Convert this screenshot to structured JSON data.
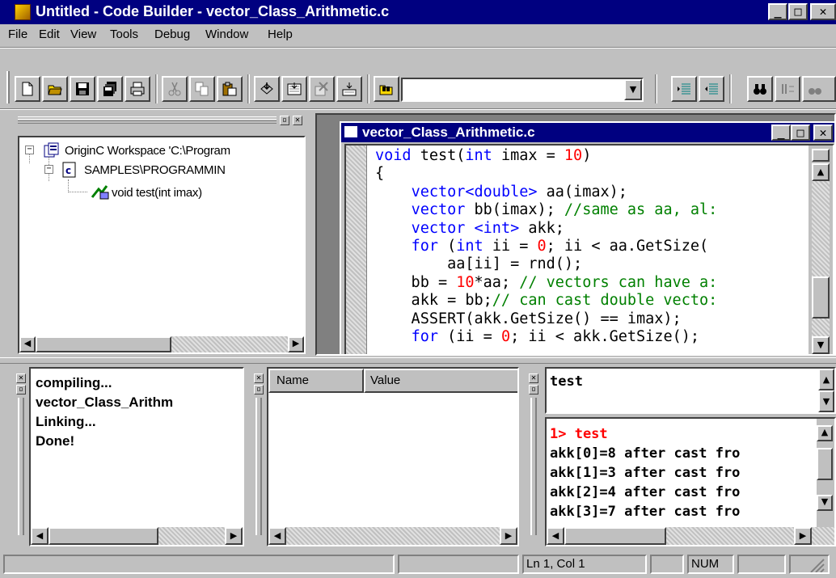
{
  "window": {
    "title": "Untitled - Code Builder - vector_Class_Arithmetic.c",
    "controls": [
      "_",
      "□",
      "✕"
    ]
  },
  "menu": [
    "File",
    "Edit",
    "View",
    "Tools",
    "Debug",
    "Window",
    "Help"
  ],
  "toolbar": {
    "buttons": [
      "new-file-icon",
      "open-folder-icon",
      "save-icon",
      "save-all-icon",
      "print-icon",
      "cut-icon",
      "copy-icon",
      "paste-icon",
      "compile-icon",
      "build-icon",
      "rebuild-icon",
      "build-all-icon",
      "find-in-files-icon",
      "indent-icon",
      "outdent-icon",
      "find-icon",
      "replace-icon"
    ],
    "combo_value": ""
  },
  "workspace": {
    "root": "OriginC Workspace 'C:\\Program",
    "file": "SAMPLES\\PROGRAMMIN",
    "function": "void test(int imax)"
  },
  "editor": {
    "title": "vector_Class_Arithmetic.c",
    "lines": [
      [
        [
          "kw",
          "void"
        ],
        [
          "t",
          " test("
        ],
        [
          "kw",
          "int"
        ],
        [
          "t",
          " imax = "
        ],
        [
          "nm",
          "10"
        ],
        [
          "t",
          ")"
        ]
      ],
      [
        [
          "t",
          "{"
        ]
      ],
      [
        [
          "t",
          "    "
        ],
        [
          "kw",
          "vector<double>"
        ],
        [
          "t",
          " aa(imax);"
        ]
      ],
      [
        [
          "t",
          "    "
        ],
        [
          "kw",
          "vector"
        ],
        [
          "t",
          " bb(imax); "
        ],
        [
          "cm",
          "//same as aa, al:"
        ]
      ],
      [
        [
          "t",
          "    "
        ],
        [
          "kw",
          "vector <int>"
        ],
        [
          "t",
          " akk;"
        ]
      ],
      [
        [
          "t",
          "    "
        ],
        [
          "kw",
          "for"
        ],
        [
          "t",
          " ("
        ],
        [
          "kw",
          "int"
        ],
        [
          "t",
          " ii = "
        ],
        [
          "nm",
          "0"
        ],
        [
          "t",
          "; ii < aa.GetSize("
        ]
      ],
      [
        [
          "t",
          "        aa[ii] = rnd();"
        ]
      ],
      [
        [
          "t",
          "    bb = "
        ],
        [
          "nm",
          "10"
        ],
        [
          "t",
          "*aa; "
        ],
        [
          "cm",
          "// vectors can have a:"
        ]
      ],
      [
        [
          "t",
          "    akk = bb;"
        ],
        [
          "cm",
          "// can cast double vecto:"
        ]
      ],
      [
        [
          "t",
          "    ASSERT(akk.GetSize() == imax);"
        ]
      ],
      [
        [
          "t",
          "    "
        ],
        [
          "kw",
          "for"
        ],
        [
          "t",
          " (ii = "
        ],
        [
          "nm",
          "0"
        ],
        [
          "t",
          "; ii < akk.GetSize();"
        ]
      ]
    ]
  },
  "output": {
    "lines": [
      "compiling...",
      "vector_Class_Arithm",
      "Linking...",
      "Done!"
    ]
  },
  "watch": {
    "columns": [
      "Name",
      "Value"
    ]
  },
  "command": {
    "input": "test",
    "lines": [
      {
        "text": "1> test",
        "color": "#ff0000"
      },
      {
        "text": "akk[0]=8 after cast fro",
        "color": "#000000"
      },
      {
        "text": "akk[1]=3 after cast fro",
        "color": "#000000"
      },
      {
        "text": "akk[2]=4 after cast fro",
        "color": "#000000"
      },
      {
        "text": "akk[3]=7 after cast fro",
        "color": "#000000"
      }
    ]
  },
  "status": {
    "position": "Ln 1, Col 1",
    "num": "NUM"
  }
}
